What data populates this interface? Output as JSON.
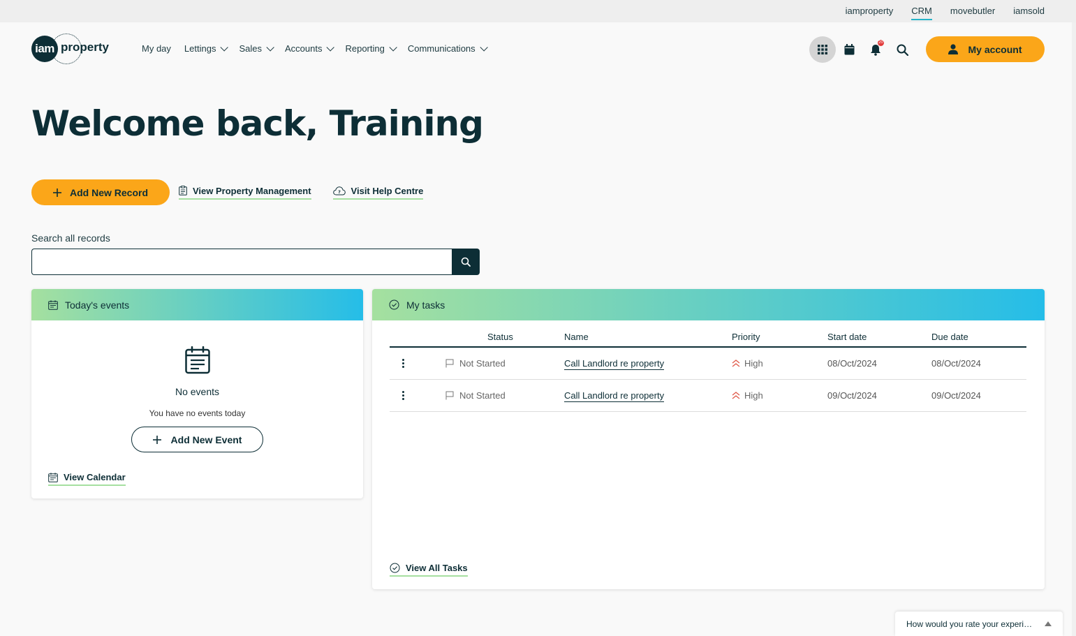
{
  "topbar": {
    "links": [
      "iamproperty",
      "CRM",
      "movebutler",
      "iamsold"
    ],
    "active": "CRM"
  },
  "logo": {
    "badge": "iam",
    "word": "property"
  },
  "nav": {
    "items": [
      {
        "label": "My day",
        "dropdown": false
      },
      {
        "label": "Lettings",
        "dropdown": true
      },
      {
        "label": "Sales",
        "dropdown": true
      },
      {
        "label": "Accounts",
        "dropdown": true
      },
      {
        "label": "Reporting",
        "dropdown": true
      },
      {
        "label": "Communications",
        "dropdown": true
      }
    ]
  },
  "header_icons": {
    "apps": "grid-icon",
    "calendar": "calendar-icon",
    "notifications": "bell-icon",
    "notification_count": "20",
    "search": "search-icon"
  },
  "account": {
    "label": "My account"
  },
  "welcome": {
    "title": "Welcome back, Training"
  },
  "actions": {
    "add_record": "Add New Record",
    "view_property": "View Property Management",
    "help": "Visit Help Centre"
  },
  "search": {
    "label": "Search all records",
    "value": "",
    "placeholder": ""
  },
  "events": {
    "title": "Today's events",
    "empty_title": "No events",
    "empty_sub": "You have no events today",
    "add_event": "Add New Event",
    "view_calendar": "View Calendar"
  },
  "tasks": {
    "title": "My tasks",
    "columns": [
      "Status",
      "Name",
      "Priority",
      "Start date",
      "Due date"
    ],
    "rows": [
      {
        "status": "Not Started",
        "name": "Call Landlord re property",
        "priority": "High",
        "start": "08/Oct/2024",
        "due": "08/Oct/2024"
      },
      {
        "status": "Not Started",
        "name": "Call Landlord re property",
        "priority": "High",
        "start": "09/Oct/2024",
        "due": "09/Oct/2024"
      }
    ],
    "view_all": "View All Tasks"
  },
  "feedback": {
    "text": "How would you rate your experience?"
  },
  "colors": {
    "brand": "#0d2e36",
    "accent": "#fba619",
    "gradient_start": "#a5e09f",
    "gradient_end": "#25bde8",
    "priority_high": "#e05a4a"
  }
}
